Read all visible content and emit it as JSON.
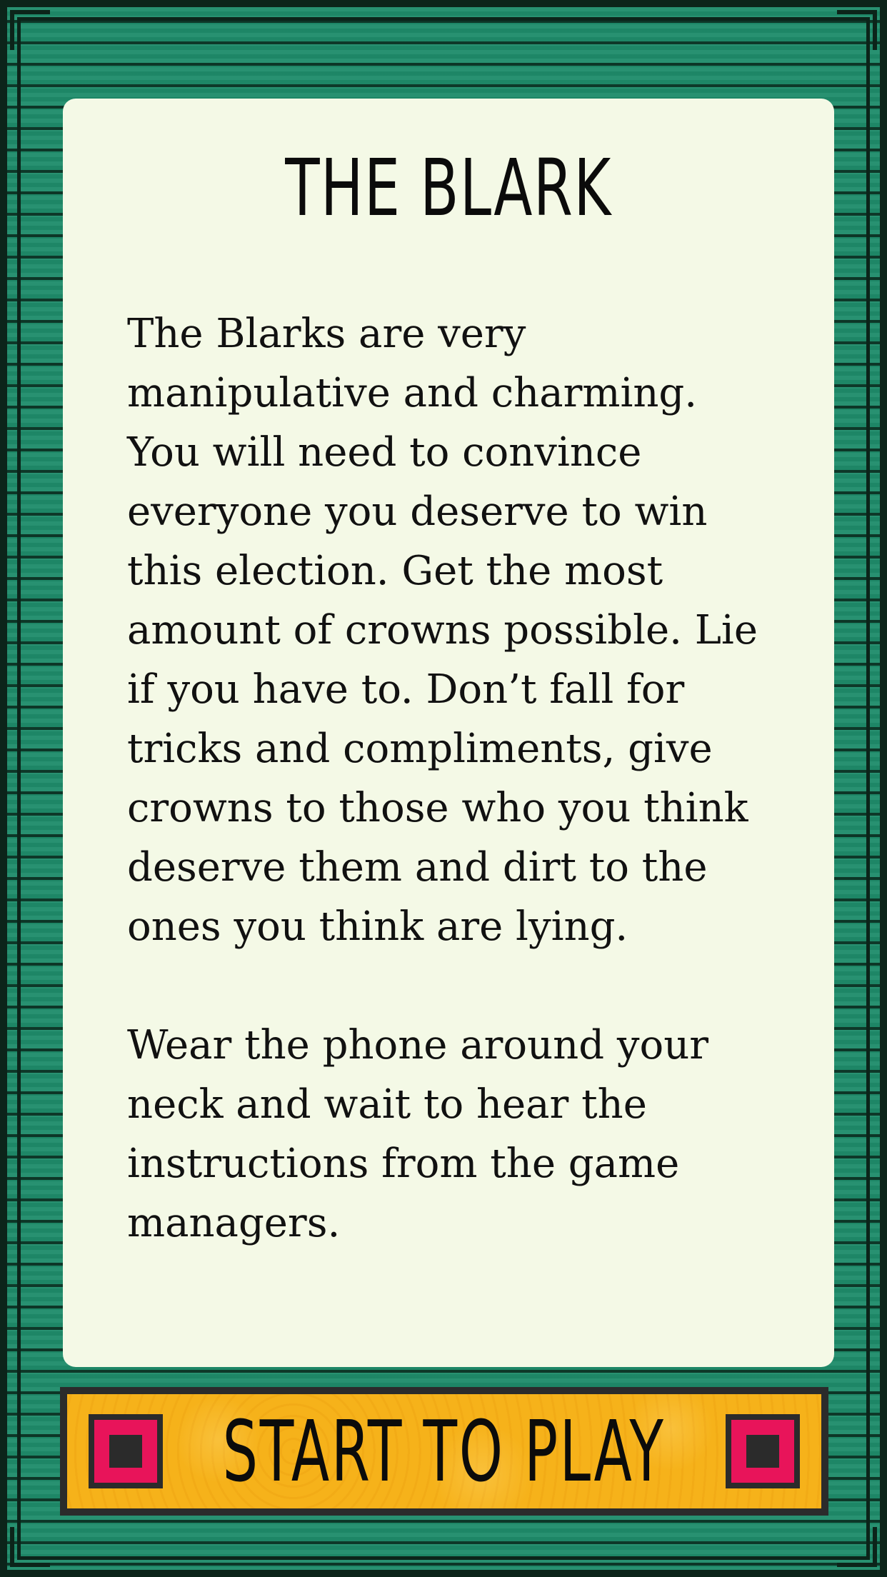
{
  "card": {
    "title": "THE BLARK",
    "paragraph_1": "The Blarks are very manipulative and charming. You will need to convince everyone you deserve to win this election. Get the most amount of crowns possible. Lie if you have to. Don’t fall for tricks and compliments, give crowns to those who you think deserve them and dirt to the ones you think are lying.",
    "paragraph_2": "Wear the phone around your neck and wait to hear the instructions from the game managers."
  },
  "start_button": {
    "label": "START TO PLAY",
    "left_icon": "square-icon",
    "right_icon": "square-icon"
  },
  "colors": {
    "frame_green": "#1f8d6b",
    "card_background": "#f4f9e6",
    "button_yellow": "#f6b21a",
    "icon_pink": "#e8145a",
    "dark": "#2b2b2b"
  }
}
